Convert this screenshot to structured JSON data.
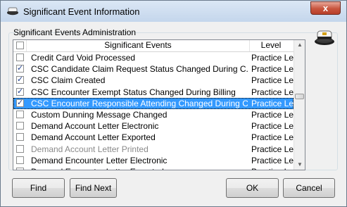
{
  "window": {
    "title": "Significant Event Information",
    "close_glyph": "x",
    "icon": "hat-icon"
  },
  "group": {
    "label": "Significant Events Administration"
  },
  "grid": {
    "columns": [
      "Significant Events",
      "Level"
    ],
    "rows": [
      {
        "name": "Credit Card Void Processed",
        "level": "Practice Level",
        "checked": false,
        "selected": false,
        "disabled": false
      },
      {
        "name": "CSC Candidate Claim Request Status Changed During C...",
        "level": "Practice Level",
        "checked": true,
        "selected": false,
        "disabled": false
      },
      {
        "name": "CSC Claim Created",
        "level": "Practice Level",
        "checked": true,
        "selected": false,
        "disabled": false
      },
      {
        "name": "CSC Encounter Exempt Status Changed During Billing",
        "level": "Practice Level",
        "checked": true,
        "selected": false,
        "disabled": false
      },
      {
        "name": "CSC Encounter Responsible Attending Changed During C...",
        "level": "Practice Level",
        "checked": true,
        "selected": true,
        "disabled": false
      },
      {
        "name": "Custom Dunning Message Changed",
        "level": "Practice Level",
        "checked": false,
        "selected": false,
        "disabled": false
      },
      {
        "name": "Demand Account Letter Electronic",
        "level": "Practice Level",
        "checked": false,
        "selected": false,
        "disabled": false
      },
      {
        "name": "Demand Account Letter Exported",
        "level": "Practice Level",
        "checked": false,
        "selected": false,
        "disabled": false
      },
      {
        "name": "Demand Account Letter Printed",
        "level": "Practice Level",
        "checked": false,
        "selected": false,
        "disabled": true
      },
      {
        "name": "Demand Encounter Letter Electronic",
        "level": "Practice Level",
        "checked": false,
        "selected": false,
        "disabled": false
      },
      {
        "name": "Demand Encounter Letter Exported",
        "level": "Practice Level",
        "checked": false,
        "selected": false,
        "disabled": false
      }
    ],
    "scroll_position": 0.42
  },
  "buttons": {
    "find": "Find",
    "find_next": "Find Next",
    "ok": "OK",
    "cancel": "Cancel"
  },
  "colors": {
    "selection": "#3399ff",
    "check": "#1c3c8c",
    "close_button": "#c8553e"
  }
}
